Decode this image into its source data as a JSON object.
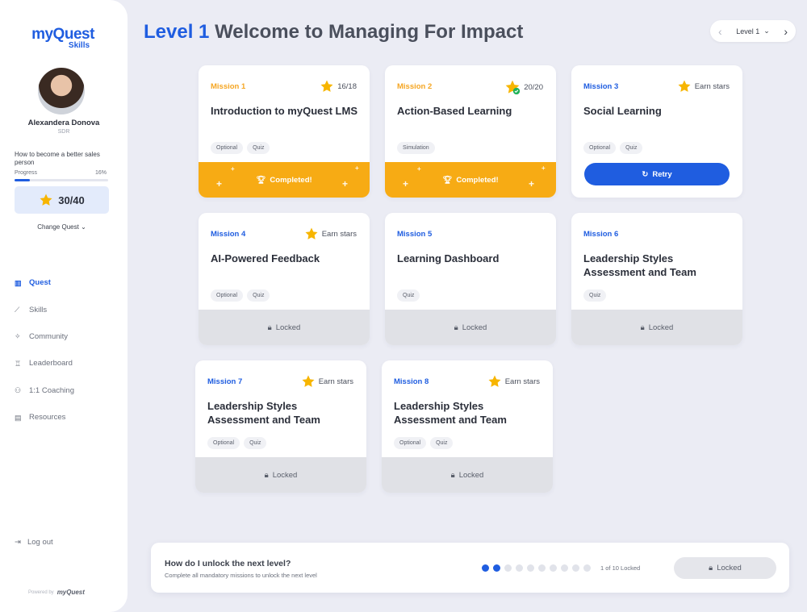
{
  "brand": {
    "name": "myQuest",
    "sub": "Skills"
  },
  "user": {
    "name": "Alexandera Donova",
    "role": "SDR"
  },
  "quest": {
    "name": "How to become a better sales person",
    "progress_label": "Progress",
    "progress_value": "16%",
    "progress_fraction": 0.16,
    "stars": "30/40",
    "change_label": "Change Quest"
  },
  "nav": [
    {
      "label": "Quest",
      "icon": "map-icon",
      "active": true
    },
    {
      "label": "Skills",
      "icon": "chart-icon",
      "active": false
    },
    {
      "label": "Community",
      "icon": "community-icon",
      "active": false
    },
    {
      "label": "Leaderboard",
      "icon": "trophy-icon",
      "active": false
    },
    {
      "label": "1:1 Coaching",
      "icon": "people-icon",
      "active": false
    },
    {
      "label": "Resources",
      "icon": "document-icon",
      "active": false
    }
  ],
  "logout_label": "Log out",
  "powered": {
    "text": "Powered by",
    "brand": "myQuest"
  },
  "header": {
    "level": "Level 1",
    "title": "Welcome to Managing For Impact"
  },
  "level_switch": {
    "value": "Level 1"
  },
  "missions": [
    {
      "number": "Mission 1",
      "stars": "16/18",
      "title": "Introduction to myQuest LMS",
      "tags": [
        "Optional",
        "Quiz"
      ],
      "status": "Completed!"
    },
    {
      "number": "Mission 2",
      "stars": "20/20",
      "title": "Action-Based Learning",
      "tags": [
        "Simulation"
      ],
      "status": "Completed!"
    },
    {
      "number": "Mission 3",
      "stars": "Earn stars",
      "title": "Social Learning",
      "tags": [
        "Optional",
        "Quiz"
      ],
      "status": "Retry"
    },
    {
      "number": "Mission 4",
      "stars": "Earn stars",
      "title": "AI-Powered Feedback",
      "tags": [
        "Optional",
        "Quiz"
      ],
      "status": "Locked"
    },
    {
      "number": "Mission 5",
      "stars": "",
      "title": "Learning Dashboard",
      "tags": [
        "Quiz"
      ],
      "status": "Locked"
    },
    {
      "number": "Mission 6",
      "stars": "",
      "title": "Leadership Styles Assessment and Team",
      "tags": [
        "Quiz"
      ],
      "status": "Locked"
    },
    {
      "number": "Mission 7",
      "stars": "Earn stars",
      "title": "Leadership Styles Assessment and Team",
      "tags": [
        "Optional",
        "Quiz"
      ],
      "status": "Locked"
    },
    {
      "number": "Mission 8",
      "stars": "Earn stars",
      "title": "Leadership Styles Assessment and Team",
      "tags": [
        "Optional",
        "Quiz"
      ],
      "status": "Locked"
    }
  ],
  "unlock": {
    "title": "How do I unlock the next level?",
    "subtitle": "Complete all mandatory missions to unlock the next level",
    "count": "1 of 10 Locked",
    "button": "Locked",
    "levels_total": 10,
    "levels_active": 2
  },
  "colors": {
    "primary": "#1f5de0",
    "accent": "#f7ab14",
    "locked": "#e0e1e6"
  }
}
